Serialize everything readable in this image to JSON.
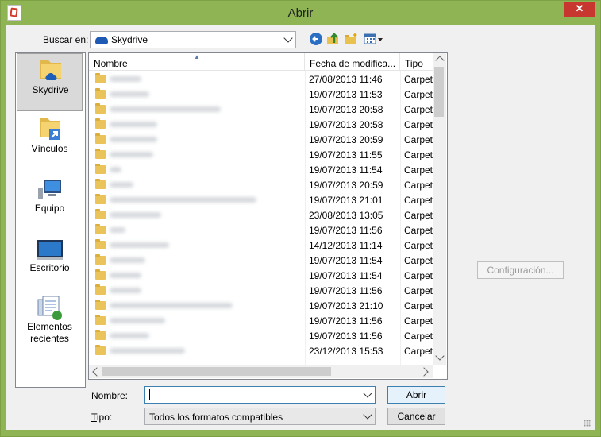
{
  "window": {
    "title": "Abrir",
    "close_glyph": "✕"
  },
  "lookin": {
    "label": "Buscar en:",
    "value": "Skydrive"
  },
  "toolbar": {
    "back_icon": "back-arrow-icon",
    "up_icon": "up-folder-icon",
    "new_folder_icon": "new-folder-icon",
    "view_icon": "view-menu-icon"
  },
  "places": [
    {
      "label": "Skydrive",
      "icon": "skydrive-folder-icon",
      "selected": true
    },
    {
      "label": "Vínculos",
      "icon": "links-folder-icon",
      "selected": false
    },
    {
      "label": "Equipo",
      "icon": "computer-icon",
      "selected": false
    },
    {
      "label": "Escritorio",
      "icon": "desktop-icon",
      "selected": false
    },
    {
      "label": "Elementos recientes",
      "icon": "recent-items-icon",
      "selected": false
    }
  ],
  "columns": {
    "name": "Nombre",
    "date": "Fecha de modifica...",
    "type": "Tipo"
  },
  "rows": [
    {
      "date": "27/08/2013 11:46",
      "type": "Carpet"
    },
    {
      "date": "19/07/2013 11:53",
      "type": "Carpet"
    },
    {
      "date": "19/07/2013 20:58",
      "type": "Carpet"
    },
    {
      "date": "19/07/2013 20:58",
      "type": "Carpet"
    },
    {
      "date": "19/07/2013 20:59",
      "type": "Carpet"
    },
    {
      "date": "19/07/2013 11:55",
      "type": "Carpet"
    },
    {
      "date": "19/07/2013 11:54",
      "type": "Carpet"
    },
    {
      "date": "19/07/2013 20:59",
      "type": "Carpet"
    },
    {
      "date": "19/07/2013 21:01",
      "type": "Carpet"
    },
    {
      "date": "23/08/2013 13:05",
      "type": "Carpet"
    },
    {
      "date": "19/07/2013 11:56",
      "type": "Carpet"
    },
    {
      "date": "14/12/2013 11:14",
      "type": "Carpet"
    },
    {
      "date": "19/07/2013 11:54",
      "type": "Carpet"
    },
    {
      "date": "19/07/2013 11:54",
      "type": "Carpet"
    },
    {
      "date": "19/07/2013 11:56",
      "type": "Carpet"
    },
    {
      "date": "19/07/2013 21:10",
      "type": "Carpet"
    },
    {
      "date": "19/07/2013 11:56",
      "type": "Carpet"
    },
    {
      "date": "19/07/2013 11:56",
      "type": "Carpet"
    },
    {
      "date": "23/12/2013 15:53",
      "type": "Carpet"
    }
  ],
  "filename": {
    "label_pre": "N",
    "label_post": "ombre:",
    "value": ""
  },
  "filetype": {
    "label_pre": "T",
    "label_post": "ipo:",
    "value": "Todos los formatos compatibles"
  },
  "buttons": {
    "open": "Abrir",
    "cancel": "Cancelar",
    "config": "Configuración..."
  }
}
